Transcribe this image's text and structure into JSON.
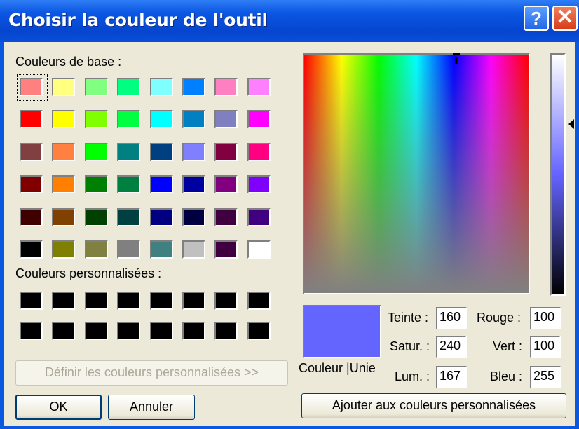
{
  "window": {
    "title": "Choisir la couleur de l'outil",
    "help_label": "?",
    "close_label": "✕"
  },
  "basic_colors_label": "Couleurs de base :",
  "basic_colors": [
    "#ff8080",
    "#ffff80",
    "#80ff80",
    "#00ff80",
    "#80ffff",
    "#0080ff",
    "#ff80c0",
    "#ff80ff",
    "#ff0000",
    "#ffff00",
    "#80ff00",
    "#00ff40",
    "#00ffff",
    "#0080c0",
    "#8080c0",
    "#ff00ff",
    "#804040",
    "#ff8040",
    "#00ff00",
    "#008080",
    "#004080",
    "#8080ff",
    "#800040",
    "#ff0080",
    "#800000",
    "#ff8000",
    "#008000",
    "#008040",
    "#0000ff",
    "#0000a0",
    "#800080",
    "#8000ff",
    "#400000",
    "#804000",
    "#004000",
    "#004040",
    "#000080",
    "#000040",
    "#400040",
    "#400080",
    "#000000",
    "#808000",
    "#808040",
    "#808080",
    "#408080",
    "#c0c0c0",
    "#400040",
    "#ffffff"
  ],
  "custom_colors_label": "Couleurs personnalisées :",
  "custom_colors": [
    "#000000",
    "#000000",
    "#000000",
    "#000000",
    "#000000",
    "#000000",
    "#000000",
    "#000000",
    "#000000",
    "#000000",
    "#000000",
    "#000000",
    "#000000",
    "#000000",
    "#000000",
    "#000000"
  ],
  "define_custom_label": "Définir les couleurs personnalisées >>",
  "ok_label": "OK",
  "cancel_label": "Annuler",
  "preview_label": "Couleur |Unie",
  "preview_color": "#6464ff",
  "fields": {
    "hue": {
      "label": "Teinte :",
      "value": "160"
    },
    "sat": {
      "label": "Satur. :",
      "value": "240"
    },
    "lum": {
      "label": "Lum. :",
      "value": "167"
    },
    "red": {
      "label": "Rouge :",
      "value": "100"
    },
    "green": {
      "label": "Vert :",
      "value": "100"
    },
    "blue": {
      "label": "Bleu :",
      "value": "255"
    }
  },
  "add_custom_label": "Ajouter aux couleurs personnalisées"
}
